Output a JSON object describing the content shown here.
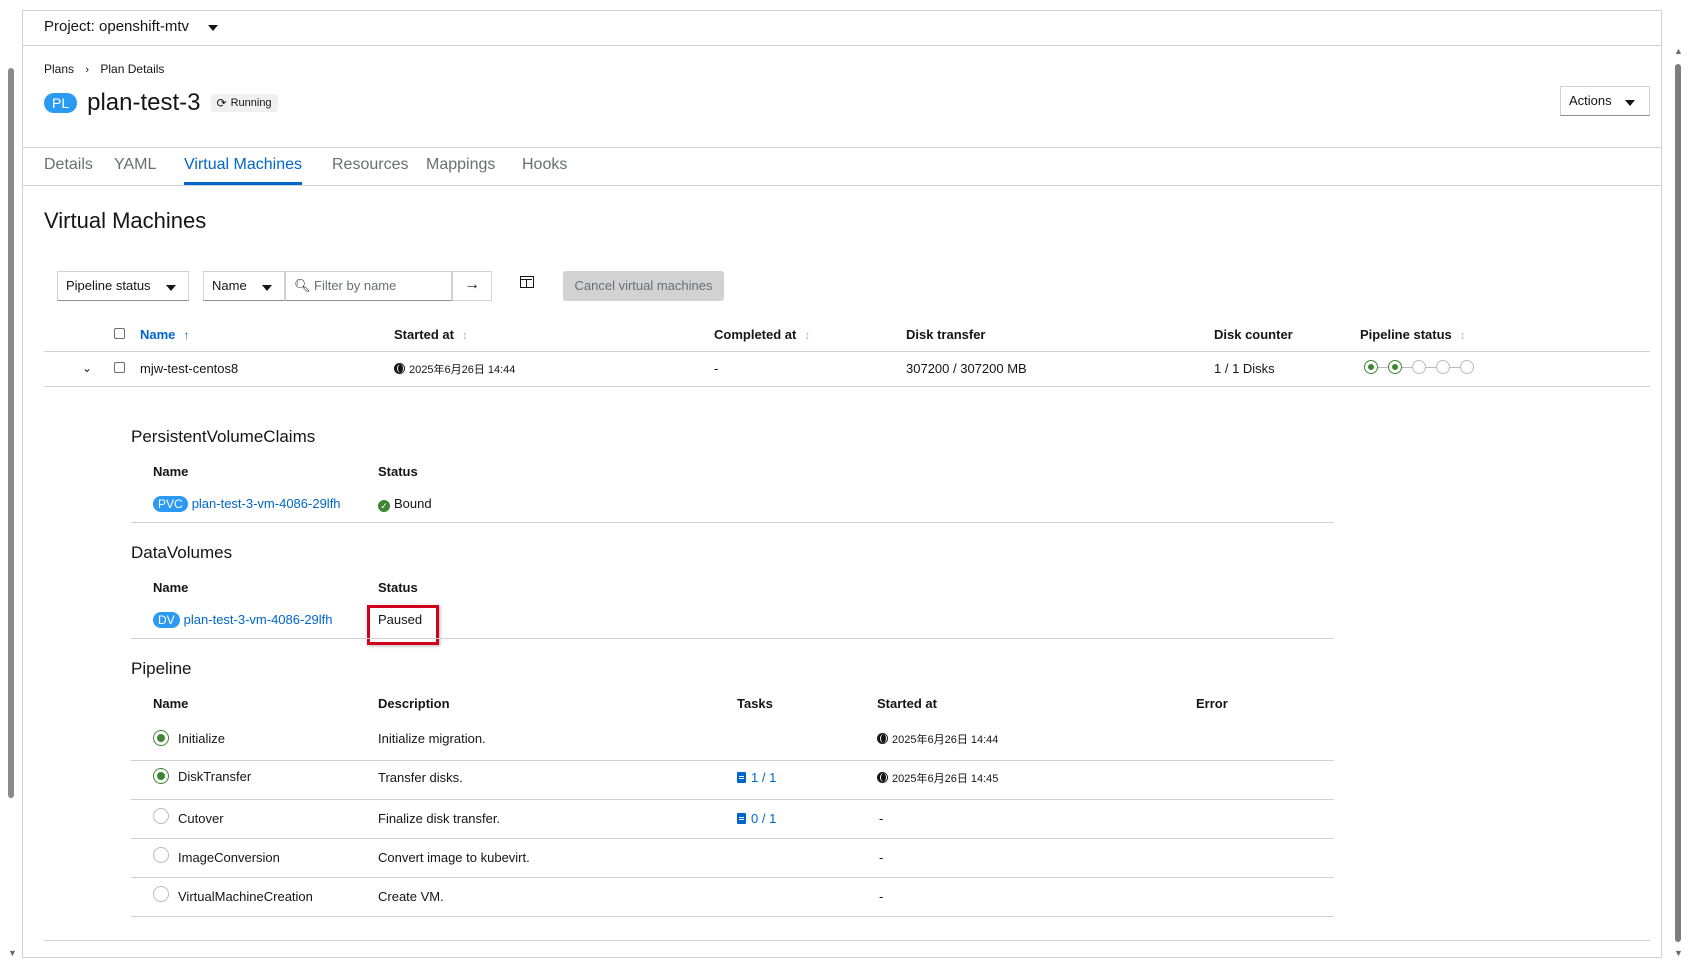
{
  "project": {
    "label": "Project: openshift-mtv"
  },
  "breadcrumb": {
    "root": "Plans",
    "current": "Plan Details"
  },
  "plan": {
    "badge": "PL",
    "name": "plan-test-3",
    "status": "Running"
  },
  "actions_label": "Actions",
  "tabs": [
    "Details",
    "YAML",
    "Virtual Machines",
    "Resources",
    "Mappings",
    "Hooks"
  ],
  "active_tab": "Virtual Machines",
  "section_title": "Virtual Machines",
  "toolbar": {
    "pipeline_filter": "Pipeline status",
    "name_filter": "Name",
    "filter_placeholder": "Filter by name",
    "cancel_label": "Cancel virtual machines"
  },
  "table": {
    "headers": {
      "name": "Name",
      "started": "Started at",
      "completed": "Completed at",
      "disk_transfer": "Disk transfer",
      "disk_counter": "Disk counter",
      "pipeline": "Pipeline status"
    },
    "row": {
      "name": "mjw-test-centos8",
      "started": "2025年6月26日 14:44",
      "completed": "-",
      "disk_transfer": "307200 / 307200 MB",
      "disk_counter": "1 / 1 Disks",
      "pipeline_steps_done": 2,
      "pipeline_steps_total": 5
    }
  },
  "pvc": {
    "title": "PersistentVolumeClaims",
    "headers": {
      "name": "Name",
      "status": "Status"
    },
    "badge": "PVC",
    "name": "plan-test-3-vm-4086-29lfh",
    "status": "Bound"
  },
  "dv": {
    "title": "DataVolumes",
    "headers": {
      "name": "Name",
      "status": "Status"
    },
    "badge": "DV",
    "name": "plan-test-3-vm-4086-29lfh",
    "status": "Paused"
  },
  "pipeline": {
    "title": "Pipeline",
    "headers": {
      "name": "Name",
      "description": "Description",
      "tasks": "Tasks",
      "started": "Started at",
      "error": "Error"
    },
    "rows": [
      {
        "name": "Initialize",
        "description": "Initialize migration.",
        "tasks": "",
        "started": "2025年6月26日 14:44",
        "done": true
      },
      {
        "name": "DiskTransfer",
        "description": "Transfer disks.",
        "tasks": "1 / 1",
        "started": "2025年6月26日 14:45",
        "done": true
      },
      {
        "name": "Cutover",
        "description": "Finalize disk transfer.",
        "tasks": "0 / 1",
        "started": "-",
        "done": false
      },
      {
        "name": "ImageConversion",
        "description": "Convert image to kubevirt.",
        "tasks": "",
        "started": "-",
        "done": false
      },
      {
        "name": "VirtualMachineCreation",
        "description": "Create VM.",
        "tasks": "",
        "started": "-",
        "done": false
      }
    ]
  }
}
